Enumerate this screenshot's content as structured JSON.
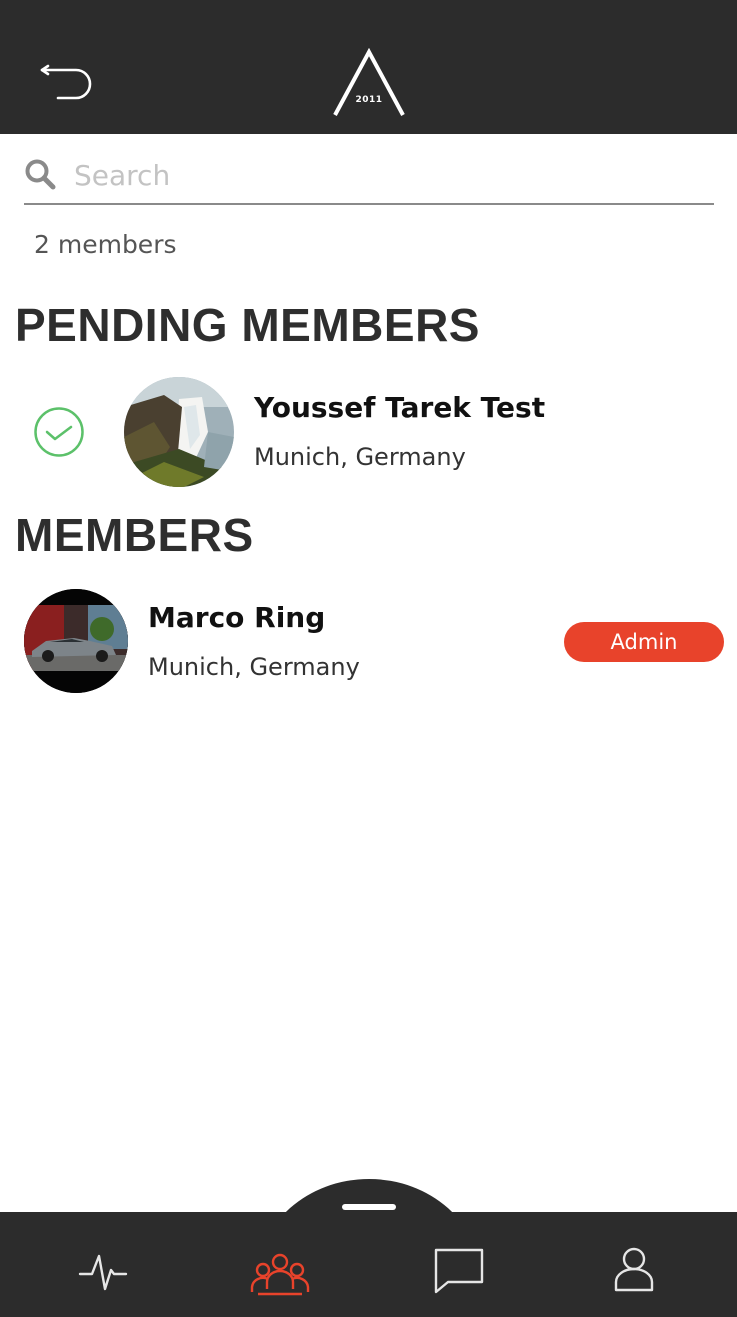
{
  "header": {
    "back_icon": "back-arrow-icon",
    "logo_text": "2011"
  },
  "search": {
    "placeholder": "Search",
    "value": ""
  },
  "members_count": "2 members",
  "pending_section": {
    "title": "PENDING MEMBERS",
    "members": [
      {
        "name": "Youssef Tarek Test",
        "location": "Munich, Germany",
        "avatar": "waterfall-photo",
        "action_icon": "check-circle-icon"
      }
    ]
  },
  "members_section": {
    "title": "MEMBERS",
    "members": [
      {
        "name": "Marco Ring",
        "location": "Munich, Germany",
        "avatar": "car-photo",
        "badge": "Admin"
      }
    ]
  },
  "tabbar": {
    "tabs": [
      {
        "icon": "activity-icon",
        "active": false
      },
      {
        "icon": "members-icon",
        "active": true
      },
      {
        "icon": "chat-icon",
        "active": false
      },
      {
        "icon": "profile-icon",
        "active": false
      }
    ]
  },
  "colors": {
    "bar_bg": "#2c2c2c",
    "accent": "#e8432b",
    "approve_green": "#5cc16a",
    "tab_inactive": "#e6e6e6"
  }
}
